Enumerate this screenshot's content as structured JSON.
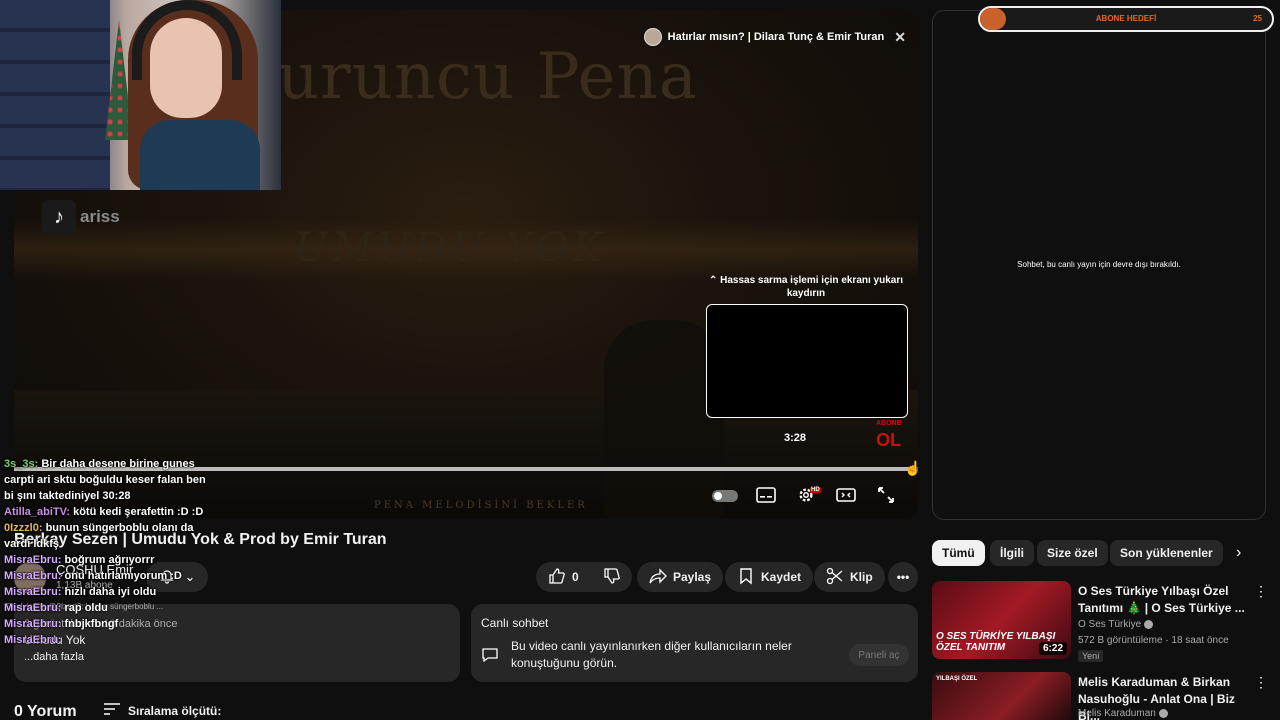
{
  "player": {
    "bg_title": "Turuncu Pena",
    "bg_subtitle": "UMUDU YOK",
    "bg_footer": "PENA MELODİSİNİ BEKLER",
    "now_playing": "Hatırlar mısın? | Dilara Tunç & Emir Turan",
    "seek_hint_line1": "⌃ Hassas sarma işlemi için ekranı yukarı",
    "seek_hint_line2": "kaydırın",
    "preview_time": "3:28",
    "progress_fraction": 0.99,
    "sub_badge_top": "ABONE",
    "sub_badge_main": "OL",
    "tiktok_handle": "ariss"
  },
  "goal": {
    "label": "ABONE HEDEFİ",
    "count": "25",
    "progress_fraction": 0.09
  },
  "live_chat_panel": {
    "disabled_text": "Sohbet, bu canlı yayın için devre dışı bırakıldı."
  },
  "video": {
    "title": "Berkay Sezen | Umudu Yok & Prod by Emir Turan",
    "channel_name": "ÇOSHU Emir",
    "channel_subs": "1,13B abone",
    "like_count": "0",
    "share_label": "Paylaş",
    "save_label": "Kaydet",
    "clip_label": "Klip"
  },
  "comments_box": {
    "reply_line": "Replying to @0Izzzl0: bunun süngerboblu ...",
    "meta": "3 görüntülenme  10 dakika önce",
    "title": "Umudu Yok",
    "more": "...daha fazla",
    "count_label": "0 Yorum",
    "sort_label": "Sıralama ölçütü:"
  },
  "live_chat_box": {
    "title": "Canlı sohbet",
    "description": "Bu video canlı yayınlanırken diğer kullanıcıların neler konuştuğunu görün.",
    "button": "Paneli aç"
  },
  "overlay_chat": [
    {
      "user": "3s_3s:",
      "text": "Bir daha desene birine gunes carpti ari sktu boğuldu keser falan ben bi şını taktediniyel 30:28",
      "cls": "u1"
    },
    {
      "user": "Atilla_abiTV:",
      "text": "kötü kedi şerafettin :D :D",
      "cls": "u2"
    },
    {
      "user": "0Izzzl0:",
      "text": "bunun süngerboblu olanı da vardı ldkfş",
      "cls": "u3"
    },
    {
      "user": "MisraEbru:",
      "text": "boğrum ağrıyorrr",
      "cls": "u4"
    },
    {
      "user": "MisraEbru:",
      "text": "onu hatırlamıyorum :D",
      "cls": "u4"
    },
    {
      "user": "MisraEbru:",
      "text": "hızlı daha iyi oldu",
      "cls": "u4"
    },
    {
      "user": "MisraEbru:",
      "text": "rap oldu",
      "cls": "u4"
    },
    {
      "user": "MisraEbru:",
      "text": "fnbjkfbngf",
      "cls": "u4"
    },
    {
      "user": "MisraEbru:",
      "text": "",
      "cls": "u4"
    }
  ],
  "chips": [
    "Tümü",
    "İlgili",
    "Size özel",
    "Son yüklenenler"
  ],
  "recommended": [
    {
      "title": "O Ses Türkiye Yılbaşı Özel Tanıtımı 🎄 | O Ses Türkiye ...",
      "channel": "O Ses Türkiye",
      "views": "572 B görüntüleme · 18 saat önce",
      "badge": "Yeni",
      "duration": "6:22",
      "thumb_text": "O SES TÜRKİYE YILBAŞI ÖZEL TANITIM"
    },
    {
      "title": "Melis Karaduman & Birkan Nasuhoğlu - Anlat Ona | Biz Bi...",
      "channel": "Melis Karaduman",
      "views": "",
      "badge": "",
      "duration": "",
      "thumb_text": "YILBAŞI ÖZEL"
    }
  ],
  "colors": {
    "bg": "#0f0f0f",
    "surface": "#272727",
    "goal_accent": "#e06a20",
    "sub_badge": "#c31212"
  }
}
